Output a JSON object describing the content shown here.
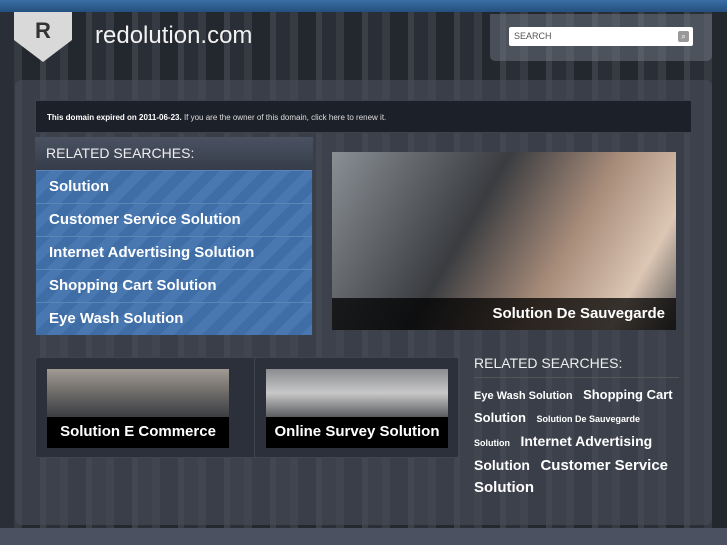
{
  "header": {
    "logo_letter": "R",
    "site_title": "redolution.com",
    "search_placeholder": "SEARCH",
    "search_icon": "magnifier-icon"
  },
  "notice": {
    "bold": "This domain expired on 2011-06-23.",
    "text": " If you are the owner of this domain, click here to renew it."
  },
  "related": {
    "heading": "RELATED SEARCHES:",
    "items": [
      {
        "label": "Solution"
      },
      {
        "label": "Customer Service Solution"
      },
      {
        "label": "Internet Advertising Solution"
      },
      {
        "label": "Shopping Cart Solution"
      },
      {
        "label": "Eye Wash Solution"
      }
    ]
  },
  "hero": {
    "caption": "Solution De Sauvegarde"
  },
  "cards": [
    {
      "caption": "Solution E Commerce"
    },
    {
      "caption": "Online Survey Solution"
    }
  ],
  "related2": {
    "heading": "RELATED SEARCHES:",
    "tags": [
      {
        "label": "Eye Wash Solution",
        "size": 11
      },
      {
        "label": "Shopping Cart Solution",
        "size": 13
      },
      {
        "label": "Solution De Sauvegarde",
        "size": 9
      },
      {
        "label": "Solution",
        "size": 9
      },
      {
        "label": "Internet Advertising Solution",
        "size": 14
      },
      {
        "label": "Customer Service Solution",
        "size": 15
      }
    ]
  }
}
